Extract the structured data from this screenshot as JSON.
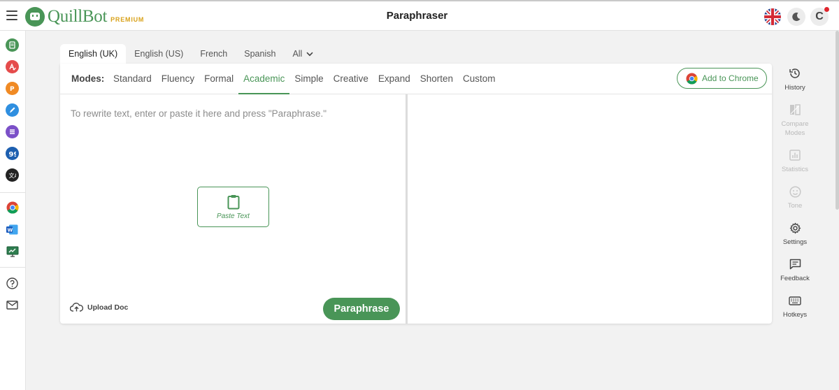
{
  "header": {
    "logo_text": "QuillBot",
    "premium_label": "PREMIUM",
    "page_title": "Paraphraser",
    "avatar_letter": "C"
  },
  "colors": {
    "brand_green": "#499557",
    "premium_gold": "#d9a21b",
    "notification_red": "#e0252d"
  },
  "left_rail": {
    "tools": [
      {
        "icon": "paraphraser-icon",
        "color": "#499557"
      },
      {
        "icon": "grammar-checker-icon",
        "color": "#e54b4b"
      },
      {
        "icon": "plagiarism-checker-icon",
        "color": "#f08a24"
      },
      {
        "icon": "co-writer-icon",
        "color": "#2f8fe0"
      },
      {
        "icon": "summarizer-icon",
        "color": "#7b50c8"
      },
      {
        "icon": "citation-generator-icon",
        "color": "#1d5fb0"
      },
      {
        "icon": "translator-icon",
        "color": "#222222"
      }
    ],
    "extensions": [
      {
        "icon": "chrome-extension-icon"
      },
      {
        "icon": "word-addin-icon"
      },
      {
        "icon": "desktop-app-icon"
      }
    ],
    "footer": [
      {
        "icon": "help-icon"
      },
      {
        "icon": "mail-icon"
      }
    ]
  },
  "languages": {
    "tabs": [
      "English (UK)",
      "English (US)",
      "French",
      "Spanish"
    ],
    "active": "English (UK)",
    "all_label": "All"
  },
  "modes": {
    "label": "Modes:",
    "items": [
      "Standard",
      "Fluency",
      "Formal",
      "Academic",
      "Simple",
      "Creative",
      "Expand",
      "Shorten",
      "Custom"
    ],
    "active": "Academic"
  },
  "add_to_chrome": "Add to Chrome",
  "editor": {
    "placeholder": "To rewrite text, enter or paste it here and press \"Paraphrase.\"",
    "paste_label": "Paste Text",
    "upload_label": "Upload Doc",
    "paraphrase_label": "Paraphrase"
  },
  "right_tools": [
    {
      "label": "History",
      "icon": "history-icon",
      "enabled": true
    },
    {
      "label": "Compare Modes",
      "icon": "compare-modes-icon",
      "enabled": false
    },
    {
      "label": "Statistics",
      "icon": "statistics-icon",
      "enabled": false
    },
    {
      "label": "Tone",
      "icon": "tone-icon",
      "enabled": false
    },
    {
      "label": "Settings",
      "icon": "settings-icon",
      "enabled": true
    },
    {
      "label": "Feedback",
      "icon": "feedback-icon",
      "enabled": true
    },
    {
      "label": "Hotkeys",
      "icon": "hotkeys-icon",
      "enabled": true
    }
  ]
}
